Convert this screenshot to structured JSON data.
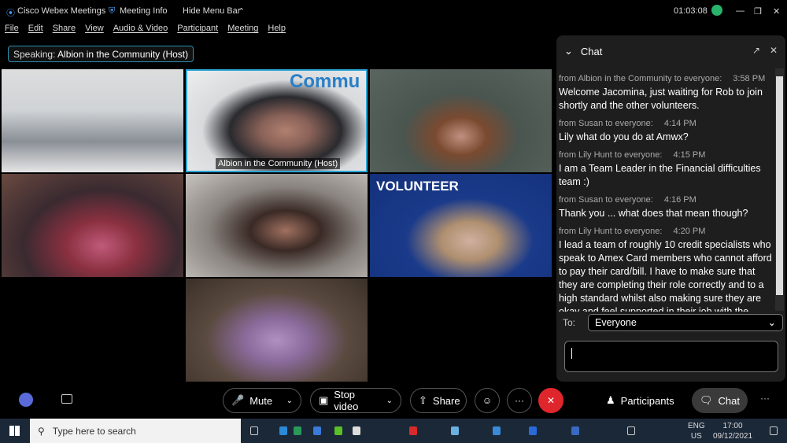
{
  "titlebar": {
    "app": "Cisco Webex Meetings",
    "meeting_info": "Meeting Info",
    "hide_menu": "Hide Menu Bar",
    "timer": "01:03:08"
  },
  "menu": [
    "File",
    "Edit",
    "Share",
    "View",
    "Audio & Video",
    "Participant",
    "Meeting",
    "Help"
  ],
  "speaking": {
    "label": "Speaking:",
    "name": "Albion in the Community (Host)"
  },
  "videos": {
    "host_label": "Albion in the Community (Host)",
    "host_banner": "Commu",
    "volunteer_banner": "VOLUNTEER"
  },
  "chat": {
    "title": "Chat",
    "messages": [
      {
        "from": "from Albion in the Community to everyone:",
        "time": "3:58 PM",
        "text": "Welcome Jacomina, just waiting for Rob to join shortly and the other volunteers."
      },
      {
        "from": "from Susan to everyone:",
        "time": "4:14 PM",
        "text": "Lily what do you do at Amwx?"
      },
      {
        "from": "from Lily Hunt to everyone:",
        "time": "4:15 PM",
        "text": "I am a Team Leader in the Financial difficulties team :)"
      },
      {
        "from": "from Susan to everyone:",
        "time": "4:16 PM",
        "text": "Thank you ... what does that mean though?"
      },
      {
        "from": "from Lily Hunt to everyone:",
        "time": "4:20 PM",
        "text": "I lead a team of roughly 10 credit specialists who speak to Amex Card members who cannot afford to pay their card/bill. I have to make sure that they are completing their role correctly and to a high standard whilst also making sure they are okay and feel supported in their job with the"
      }
    ],
    "to_label": "To:",
    "to_value": "Everyone",
    "input_value": ""
  },
  "controls": {
    "mute": "Mute",
    "stop_video": "Stop video",
    "share": "Share",
    "more": "···",
    "participants": "Participants",
    "chat": "Chat"
  },
  "taskbar": {
    "search_placeholder": "Type here to search",
    "lang1": "ENG",
    "lang2": "US",
    "time": "17:00",
    "date": "09/12/2021"
  },
  "colors": {
    "accent": "#2a8fb0",
    "end_call": "#e0262d",
    "signal": "#27b36b"
  }
}
